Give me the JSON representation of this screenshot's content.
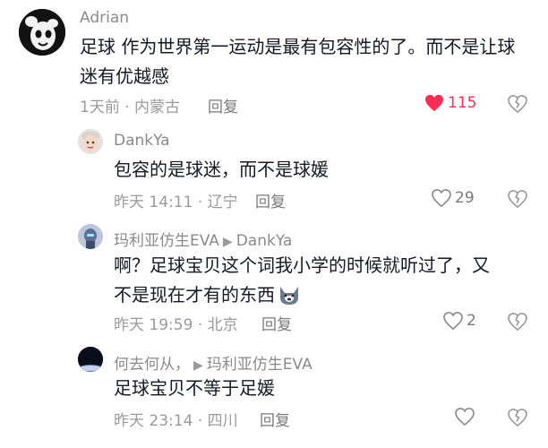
{
  "colors": {
    "accent": "#fe2c55",
    "text": "#161823",
    "muted": "#8a8a8a"
  },
  "comments": [
    {
      "author": "Adrian",
      "text": "足球 作为世界第一运动是最有包容性的了。而不是让球迷有优越感",
      "time": "1天前",
      "location": "内蒙古",
      "reply_label": "回复",
      "likes": "115",
      "liked": true
    },
    {
      "author": "DankYa",
      "text": "包容的是球迷，而不是球媛",
      "time": "昨天 14:11",
      "location": "辽宁",
      "reply_label": "回复",
      "likes": "29",
      "liked": false
    },
    {
      "author": "玛利亚仿生EVA",
      "reply_to": "DankYa",
      "text_line1": "啊？足球宝贝这个词我小学的时候就听过了，又",
      "text_line2": "不是现在才有的东西",
      "emoji": "husky-emoji",
      "time": "昨天 19:59",
      "location": "北京",
      "reply_label": "回复",
      "likes": "2",
      "liked": false
    },
    {
      "author": "何去何从，",
      "reply_to": "玛利亚仿生EVA",
      "text": "足球宝贝不等于足媛",
      "time": "昨天 23:14",
      "location": "四川",
      "reply_label": "回复",
      "likes": "",
      "liked": false
    }
  ]
}
